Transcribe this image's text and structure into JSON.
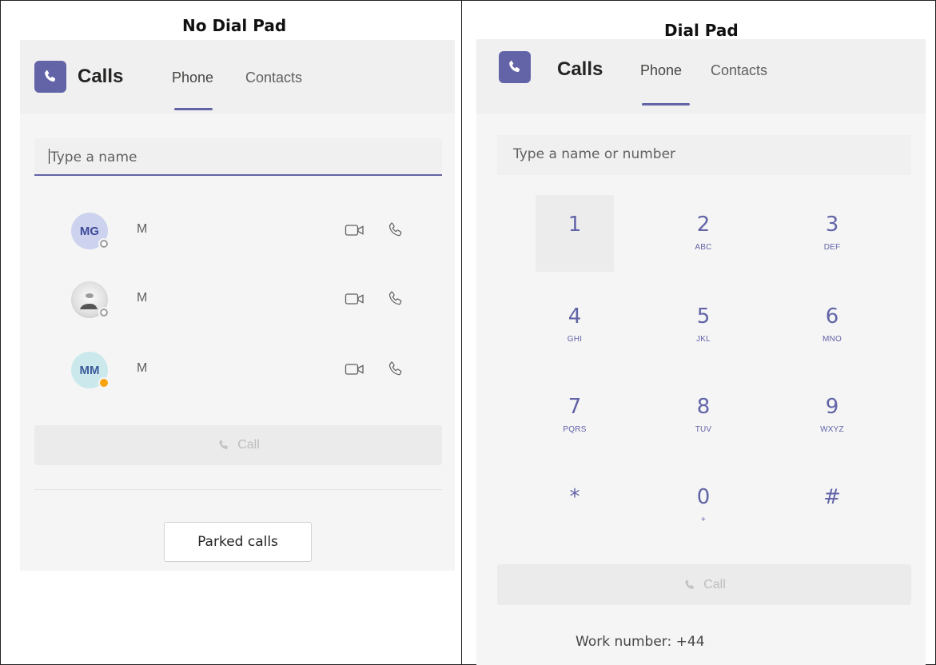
{
  "captions": {
    "left": "No Dial Pad",
    "right": "Dial Pad"
  },
  "app": {
    "title": "Calls",
    "tabs": [
      "Phone",
      "Contacts"
    ],
    "active_tab": "Phone",
    "accent": "#6264a7"
  },
  "no_dial_pad": {
    "search_placeholder": "Type a name",
    "contacts": [
      {
        "initials": "MG",
        "name": "M",
        "presence": "offline"
      },
      {
        "initials": "",
        "name": "M",
        "presence": "offline"
      },
      {
        "initials": "MM",
        "name": "M",
        "presence": "away"
      }
    ],
    "call_label": "Call",
    "parked_label": "Parked calls"
  },
  "dial_pad": {
    "search_placeholder": "Type a name or number",
    "keys": [
      {
        "digit": "1",
        "letters": ""
      },
      {
        "digit": "2",
        "letters": "ABC"
      },
      {
        "digit": "3",
        "letters": "DEF"
      },
      {
        "digit": "4",
        "letters": "GHI"
      },
      {
        "digit": "5",
        "letters": "JKL"
      },
      {
        "digit": "6",
        "letters": "MNO"
      },
      {
        "digit": "7",
        "letters": "PQRS"
      },
      {
        "digit": "8",
        "letters": "TUV"
      },
      {
        "digit": "9",
        "letters": "WXYZ"
      },
      {
        "digit": "*",
        "letters": ""
      },
      {
        "digit": "0",
        "letters": "+"
      },
      {
        "digit": "#",
        "letters": ""
      }
    ],
    "call_label": "Call",
    "work_number": "Work number: +44"
  }
}
